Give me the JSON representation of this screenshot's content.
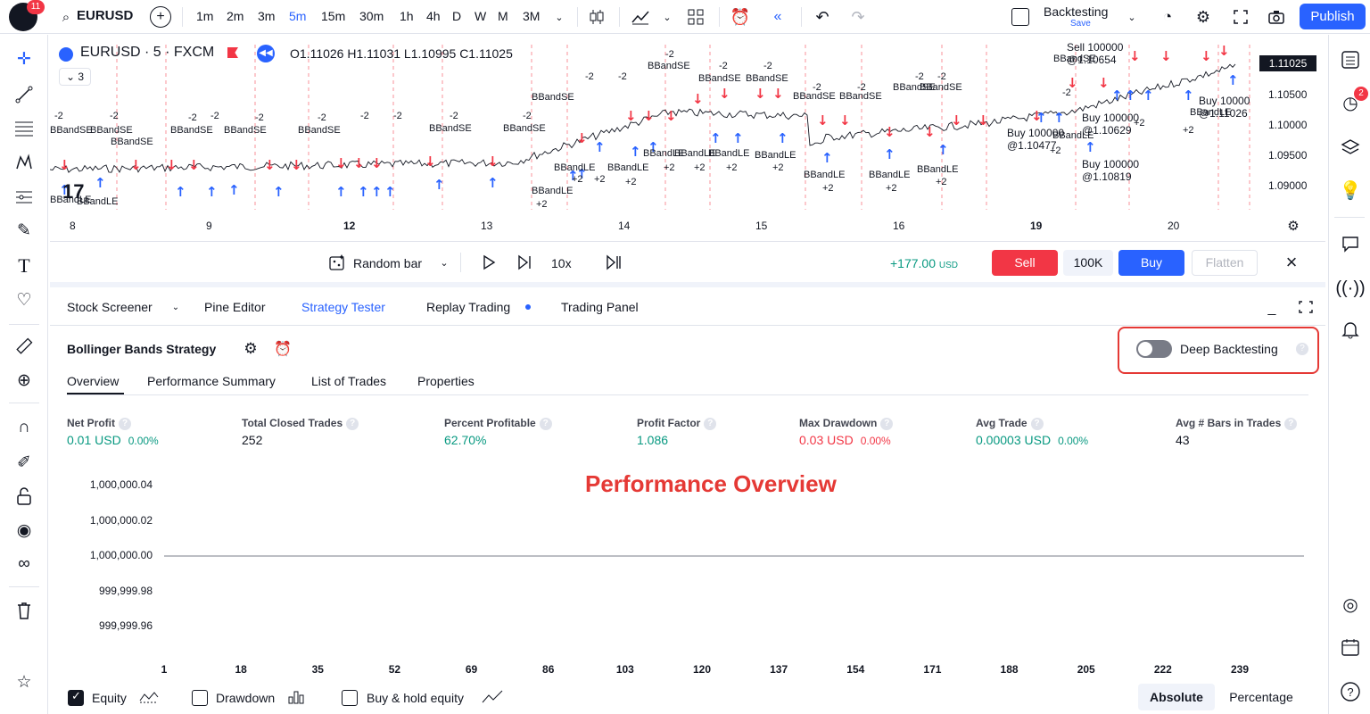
{
  "topbar": {
    "logo_badge": "11",
    "symbol": "EURUSD",
    "timeframes": [
      "1m",
      "2m",
      "3m",
      "5m",
      "15m",
      "30m",
      "1h",
      "4h",
      "D",
      "W",
      "M",
      "3M"
    ],
    "active_timeframe": "5m",
    "layout_name": "Backtesting",
    "layout_sub": "Save",
    "publish_label": "Publish"
  },
  "chart": {
    "title": "EURUSD · 5 · FXCM",
    "ohlc": "O1.11026 H1.11031 L1.10995 C1.11025",
    "collapse_count": "3",
    "current_price": "1.11025",
    "price_ticks": [
      "1.10500",
      "1.10000",
      "1.09500",
      "1.09000"
    ],
    "date_ticks": [
      "8",
      "9",
      "12",
      "13",
      "14",
      "15",
      "16",
      "19",
      "20"
    ],
    "bold_dates": [
      "12",
      "19"
    ],
    "annotations": [
      {
        "t": "BBandSE",
        "group": "upper"
      },
      {
        "t": "BBandLE",
        "group": "lower"
      },
      {
        "t": "-2",
        "group": "upper"
      },
      {
        "t": "+2",
        "group": "lower"
      },
      {
        "t": "Buy 10000 @1.11026",
        "group": "upper"
      },
      {
        "t": "Buy 100000 @1.10819",
        "group": "lower"
      },
      {
        "t": "Sell 100000 @1.10654",
        "group": "upper"
      },
      {
        "t": "Buy 100000 @1.10629",
        "group": "upper"
      },
      {
        "t": "Buy 100000 @1.10477",
        "group": "upper"
      }
    ],
    "tv_logo": "17"
  },
  "replay": {
    "mode_label": "Random bar",
    "speed": "10x",
    "pnl": "+177.00",
    "pnl_unit": "USD",
    "sell_label": "Sell",
    "qty": "100K",
    "buy_label": "Buy",
    "flatten_label": "Flatten"
  },
  "bottom_tabs": [
    {
      "label": "Stock Screener"
    },
    {
      "label": "Pine Editor"
    },
    {
      "label": "Strategy Tester"
    },
    {
      "label": "Replay Trading"
    },
    {
      "label": "Trading Panel"
    }
  ],
  "active_bottom_tab": "Strategy Tester",
  "strategy": {
    "name": "Bollinger Bands Strategy",
    "deep_backtesting_label": "Deep Backtesting",
    "subtabs": [
      "Overview",
      "Performance Summary",
      "List of Trades",
      "Properties"
    ],
    "active_subtab": "Overview"
  },
  "metrics": [
    {
      "label": "Net Profit",
      "value": "0.01 USD",
      "pct": "0.00%",
      "tone": "green"
    },
    {
      "label": "Total Closed Trades",
      "value": "252",
      "pct": "",
      "tone": "neutral"
    },
    {
      "label": "Percent Profitable",
      "value": "62.70%",
      "pct": "",
      "tone": "green"
    },
    {
      "label": "Profit Factor",
      "value": "1.086",
      "pct": "",
      "tone": "green"
    },
    {
      "label": "Max Drawdown",
      "value": "0.03 USD",
      "pct": "0.00%",
      "tone": "red"
    },
    {
      "label": "Avg Trade",
      "value": "0.00003 USD",
      "pct": "0.00%",
      "tone": "green"
    },
    {
      "label": "Avg # Bars in Trades",
      "value": "43",
      "pct": "",
      "tone": "neutral"
    }
  ],
  "overlay_title": "Performance Overview",
  "chart_data": {
    "type": "line",
    "title": "",
    "xlabel": "",
    "ylabel": "",
    "y_ticks": [
      "1,000,000.04",
      "1,000,000.02",
      "1,000,000.00",
      "999,999.98",
      "999,999.96"
    ],
    "x_ticks": [
      "1",
      "18",
      "35",
      "52",
      "69",
      "86",
      "103",
      "120",
      "137",
      "154",
      "171",
      "188",
      "205",
      "222",
      "239"
    ],
    "ylim": [
      999999.96,
      1000000.04
    ],
    "xlim": [
      1,
      252
    ],
    "series": [
      {
        "name": "Equity",
        "x": [
          1,
          252
        ],
        "values": [
          1000000.0,
          1000000.0
        ]
      }
    ],
    "grid": false
  },
  "legend": {
    "equity": "Equity",
    "drawdown": "Drawdown",
    "buyhold": "Buy & hold equity",
    "absolute": "Absolute",
    "percentage": "Percentage"
  }
}
